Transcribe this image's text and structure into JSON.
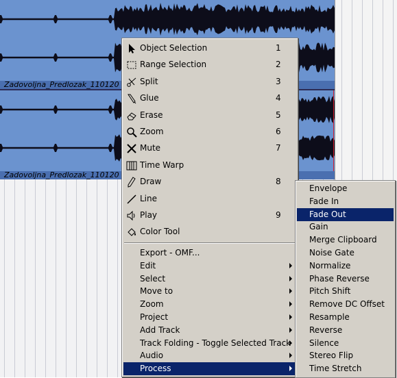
{
  "clips": [
    {
      "name": "Zadovoljna_Predlozak_110120"
    },
    {
      "name": "Zadovoljna_Predlozak_110120"
    }
  ],
  "context_menu": {
    "tools": [
      {
        "label": "Object Selection",
        "key": "1",
        "icon": "arrow-pointer-icon"
      },
      {
        "label": "Range Selection",
        "key": "2",
        "icon": "range-selection-icon"
      },
      {
        "label": "Split",
        "key": "3",
        "icon": "scissors-icon"
      },
      {
        "label": "Glue",
        "key": "4",
        "icon": "glue-tube-icon"
      },
      {
        "label": "Erase",
        "key": "5",
        "icon": "eraser-icon"
      },
      {
        "label": "Zoom",
        "key": "6",
        "icon": "magnifier-icon"
      },
      {
        "label": "Mute",
        "key": "7",
        "icon": "mute-x-icon"
      },
      {
        "label": "Time Warp",
        "key": "",
        "icon": "time-warp-icon"
      },
      {
        "label": "Draw",
        "key": "8",
        "icon": "pencil-icon"
      },
      {
        "label": "Line",
        "key": "",
        "icon": "line-icon"
      },
      {
        "label": "Play",
        "key": "9",
        "icon": "speaker-icon"
      },
      {
        "label": "Color Tool",
        "key": "",
        "icon": "color-bucket-icon"
      }
    ],
    "actions": [
      {
        "label": "Export - OMF...",
        "submenu": false
      },
      {
        "label": "Edit",
        "submenu": true
      },
      {
        "label": "Select",
        "submenu": true
      },
      {
        "label": "Move to",
        "submenu": true
      },
      {
        "label": "Zoom",
        "submenu": true
      },
      {
        "label": "Project",
        "submenu": true
      },
      {
        "label": "Add Track",
        "submenu": true
      },
      {
        "label": "Track Folding - Toggle Selected Track",
        "submenu": true
      },
      {
        "label": "Audio",
        "submenu": true
      },
      {
        "label": "Process",
        "submenu": true,
        "highlighted": true
      }
    ]
  },
  "process_submenu": {
    "items": [
      {
        "label": "Envelope"
      },
      {
        "label": "Fade In"
      },
      {
        "label": "Fade Out",
        "highlighted": true
      },
      {
        "label": "Gain"
      },
      {
        "label": "Merge Clipboard"
      },
      {
        "label": "Noise Gate"
      },
      {
        "label": "Normalize"
      },
      {
        "label": "Phase Reverse"
      },
      {
        "label": "Pitch Shift"
      },
      {
        "label": "Remove DC Offset"
      },
      {
        "label": "Resample"
      },
      {
        "label": "Reverse"
      },
      {
        "label": "Silence"
      },
      {
        "label": "Stereo Flip"
      },
      {
        "label": "Time Stretch"
      }
    ]
  },
  "colors": {
    "menu_bg": "#d4d0c8",
    "highlight": "#0a246a",
    "clip_bg": "#6b93cf",
    "waveform": "#0d0d1a"
  }
}
